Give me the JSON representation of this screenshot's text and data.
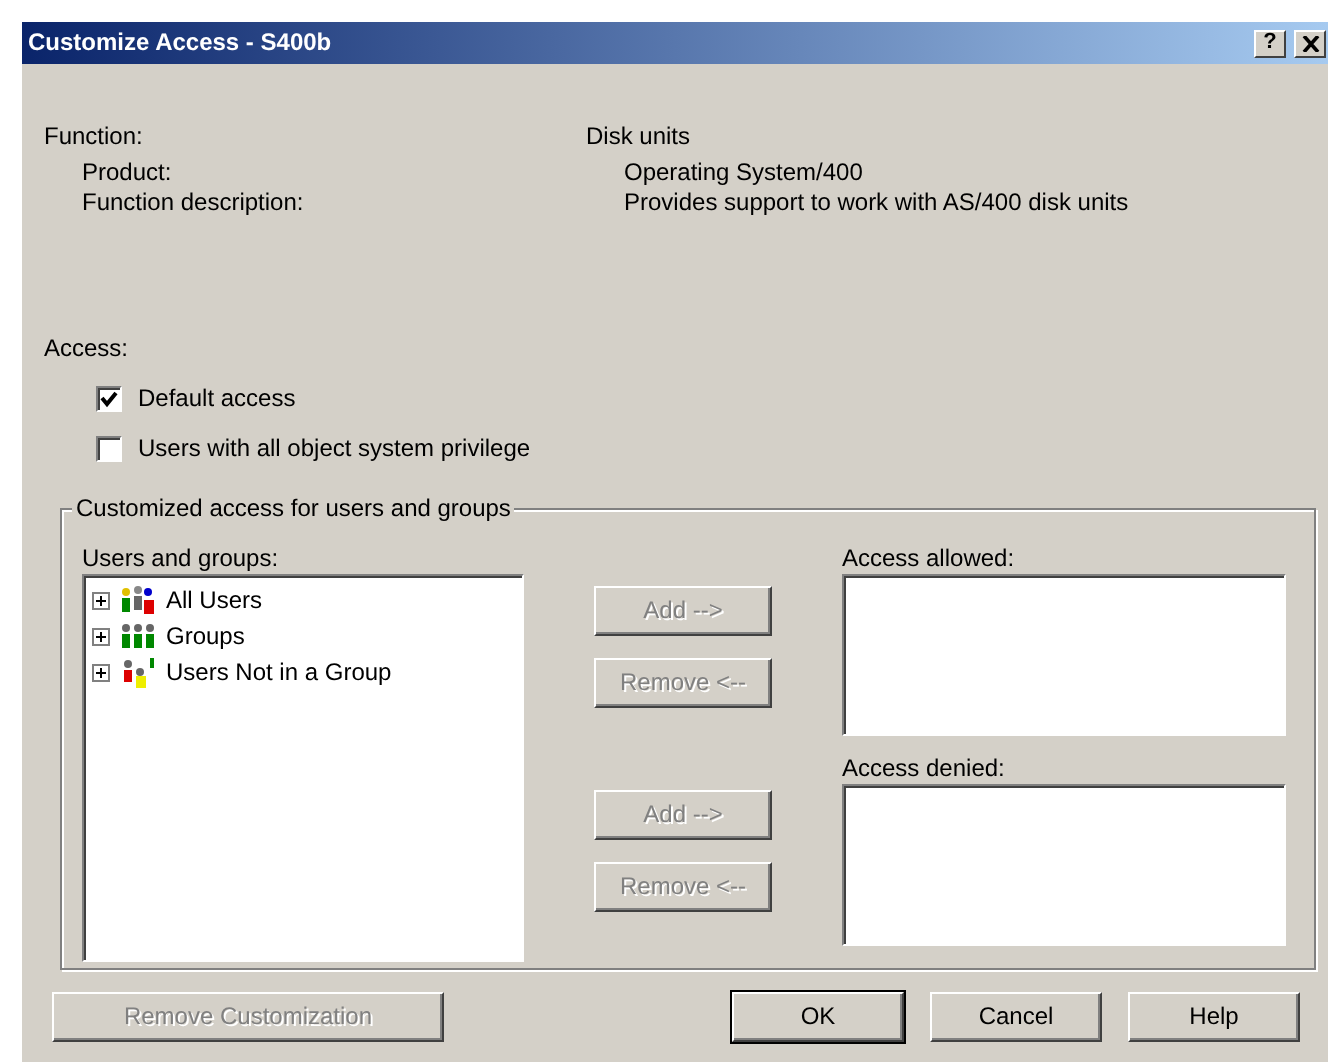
{
  "window": {
    "title": "Customize Access - S400b",
    "title_buttons": [
      "?"
    ]
  },
  "info": [
    {
      "label": "Function:",
      "value": "Disk units",
      "kind": "heading"
    },
    {
      "label": "Product:",
      "value": "Operating System/400",
      "kind": "detail"
    },
    {
      "label": "Function description:",
      "value": "Provides support to work with AS/400 disk units",
      "kind": "detail"
    }
  ],
  "access": {
    "label": "Access:",
    "options": [
      {
        "label": "Default access",
        "checked": true
      },
      {
        "label": "Users with all object system privilege",
        "checked": false
      }
    ]
  },
  "customized": {
    "legend": "Customized access for users and groups",
    "users_label": "Users and groups:",
    "tree": [
      {
        "label": "All Users",
        "expanded": false,
        "kind": "all-users"
      },
      {
        "label": "Groups",
        "expanded": false,
        "kind": "groups"
      },
      {
        "label": "Users Not in a Group",
        "expanded": false,
        "kind": "ungrouped"
      }
    ],
    "lists": [
      {
        "label": "Access allowed:",
        "buttons": [
          {
            "label": "Add -->",
            "disabled": true
          },
          {
            "label": "Remove <--",
            "disabled": true
          }
        ]
      },
      {
        "label": "Access denied:",
        "buttons": [
          {
            "label": "Add -->",
            "disabled": true
          },
          {
            "label": "Remove <--",
            "disabled": true
          }
        ]
      }
    ]
  },
  "footer_buttons": [
    {
      "label": "Remove Customization",
      "disabled": true,
      "default": false
    },
    {
      "label": "OK",
      "disabled": false,
      "default": true
    },
    {
      "label": "Cancel",
      "disabled": false,
      "default": false
    },
    {
      "label": "Help",
      "disabled": false,
      "default": false
    }
  ]
}
